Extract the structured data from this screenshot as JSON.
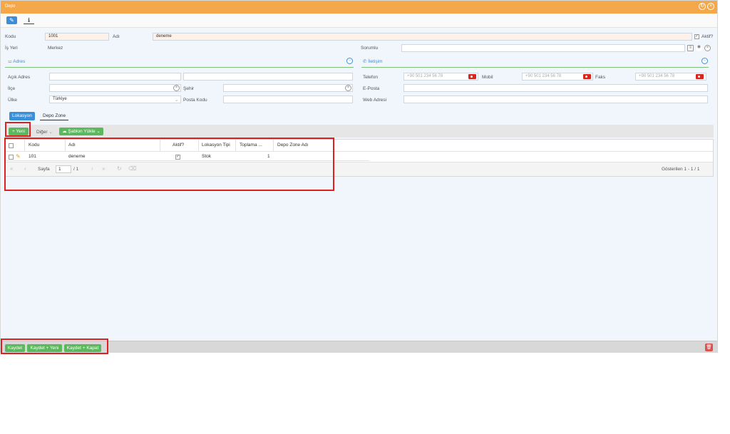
{
  "window": {
    "title": "Depo"
  },
  "toolbar": {
    "edit_icon": "edit-icon",
    "info_icon": "info-icon"
  },
  "form": {
    "kodu_label": "Kodu",
    "kodu_value": "1001",
    "adi_label": "Adı",
    "adi_value": "deneme",
    "aktif_label": "Aktif?",
    "isyeri_label": "İş Yeri",
    "isyeri_value": "Merkez",
    "sorumlu_label": "Sorumlu",
    "sorumlu_value": ""
  },
  "adres": {
    "title": "Adres",
    "acik_adres_label": "Açık Adres",
    "ilce_label": "İlçe",
    "sehir_label": "Şehir",
    "ulke_label": "Ülke",
    "ulke_value": "Türkiye",
    "posta_kodu_label": "Posta Kodu"
  },
  "iletisim": {
    "title": "İletişim",
    "telefon_label": "Telefon",
    "telefon_placeholder": "+90 501 234 56 78",
    "mobil_label": "Mobil",
    "mobil_placeholder": "+90 501 234 56 78",
    "faks_label": "Faks",
    "faks_placeholder": "+90 501 234 56 78",
    "eposta_label": "E-Posta",
    "web_label": "Web Adresi"
  },
  "tabs": [
    {
      "label": "Lokasyon"
    },
    {
      "label": "Depo Zone"
    }
  ],
  "grid_toolbar": {
    "yeni": "Yeni",
    "diger": "Diğer",
    "sablon": "Şablon Yükle"
  },
  "grid": {
    "columns": [
      "Kodu",
      "Adı",
      "Aktif?",
      "Lokasyon Tipi",
      "Toplama ...",
      "Depo Zone Adı"
    ],
    "rows": [
      {
        "kodu": "101",
        "adi": "deneme",
        "aktif": true,
        "tip": "Stok",
        "toplama": "1",
        "zone": ""
      }
    ]
  },
  "pager": {
    "page_label": "Sayfa",
    "page_value": "1",
    "of_label": "/ 1",
    "summary": "Gösterilen 1 - 1 / 1"
  },
  "footer": {
    "kaydet": "Kaydet",
    "kaydet_yeni": "Kaydet + Yeni",
    "kaydet_kapat": "Kaydet + Kapat"
  },
  "colors": {
    "title_bar": "#f5a84a",
    "accent": "#3a8fd8",
    "green": "#5cb85c",
    "highlight": "#e0201e"
  }
}
